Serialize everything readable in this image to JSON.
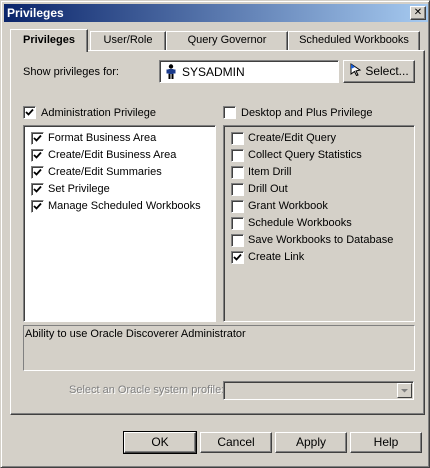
{
  "window": {
    "title": "Privileges",
    "close_glyph": "✕"
  },
  "tabs": [
    {
      "label": "Privileges",
      "active": true
    },
    {
      "label": "User/Role",
      "active": false
    },
    {
      "label": "Query Governor",
      "active": false
    },
    {
      "label": "Scheduled Workbooks",
      "active": false
    }
  ],
  "show_for": {
    "label": "Show privileges for:",
    "value": "SYSADMIN",
    "icon": "user-icon",
    "select_label": "Select..."
  },
  "admin_privilege": {
    "label": "Administration Privilege",
    "checked": true,
    "items": [
      {
        "label": "Format Business Area",
        "checked": true
      },
      {
        "label": "Create/Edit Business Area",
        "checked": true
      },
      {
        "label": "Create/Edit Summaries",
        "checked": true
      },
      {
        "label": "Set Privilege",
        "checked": true
      },
      {
        "label": "Manage Scheduled Workbooks",
        "checked": true
      }
    ]
  },
  "desktop_privilege": {
    "label": "Desktop and Plus Privilege",
    "checked": false,
    "items": [
      {
        "label": "Create/Edit Query",
        "checked": false
      },
      {
        "label": "Collect Query Statistics",
        "checked": false
      },
      {
        "label": "Item Drill",
        "checked": false
      },
      {
        "label": "Drill Out",
        "checked": false
      },
      {
        "label": "Grant Workbook",
        "checked": false
      },
      {
        "label": "Schedule Workbooks",
        "checked": false
      },
      {
        "label": "Save Workbooks to Database",
        "checked": false
      },
      {
        "label": "Create Link",
        "checked": true
      }
    ]
  },
  "description": "Ability to use Oracle Discoverer Administrator",
  "system_profile": {
    "label": "Select an Oracle system profile:",
    "value": ""
  },
  "buttons": {
    "ok": "OK",
    "cancel": "Cancel",
    "apply": "Apply",
    "help": "Help"
  }
}
